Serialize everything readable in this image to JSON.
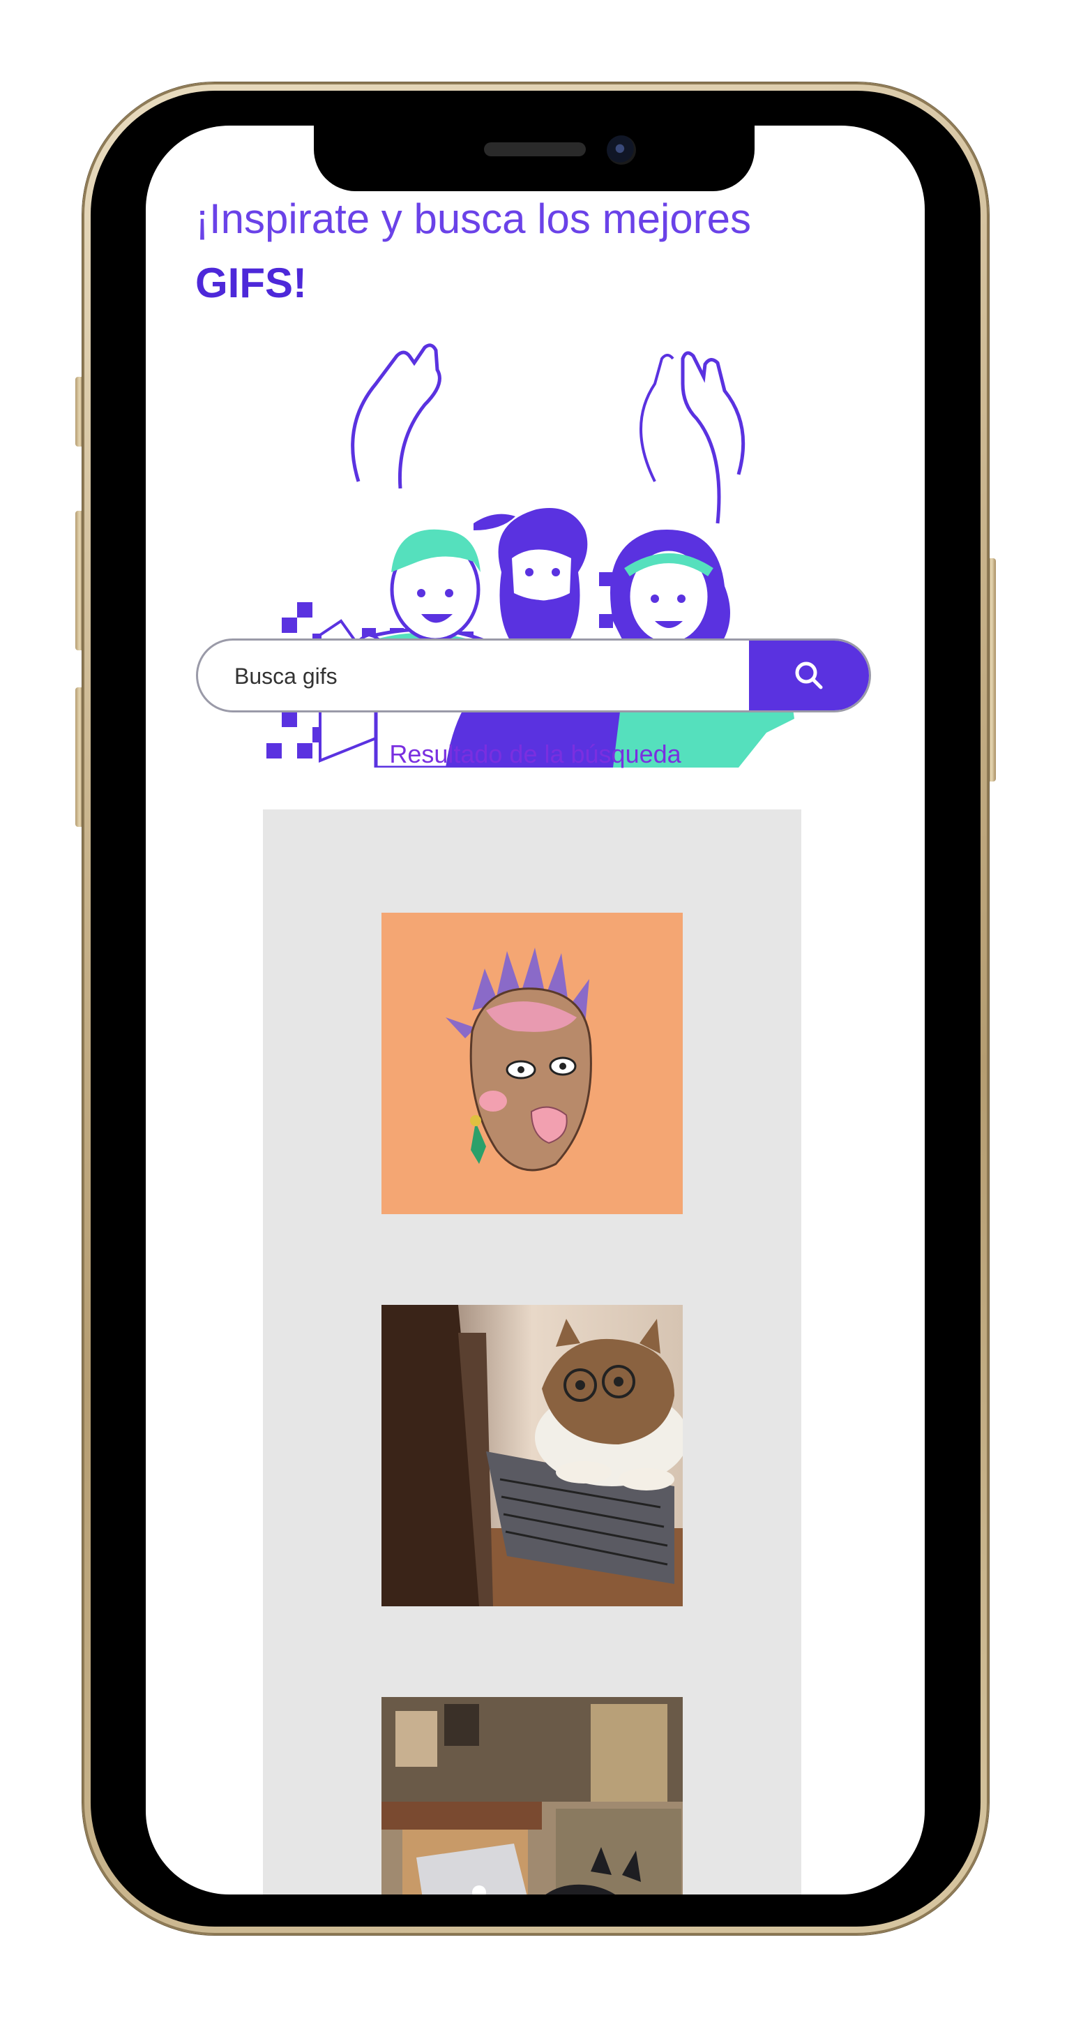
{
  "page": {
    "heading_line1": "¡Inspirate y busca los mejores",
    "heading_line2": "GIFS!"
  },
  "search": {
    "placeholder": "Busca gifs",
    "button_icon": "search-icon"
  },
  "results": {
    "title": "Resultado de la búsqueda",
    "items": [
      {
        "kind": "illustrated-face-gif"
      },
      {
        "kind": "cat-typing-laptop-gif"
      },
      {
        "kind": "cat-at-laptop-room-gif"
      }
    ]
  },
  "colors": {
    "accent": "#5a32e0",
    "heading": "#6a42e8",
    "results_title": "#7a2fe0",
    "teal": "#55e0bd",
    "panel_bg": "#e6e6e6"
  }
}
